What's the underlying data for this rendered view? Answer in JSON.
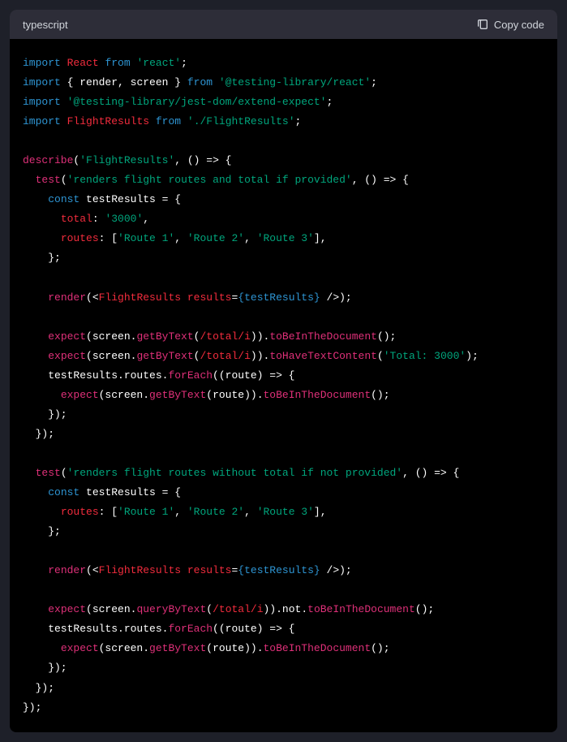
{
  "header": {
    "language": "typescript",
    "copyLabel": "Copy code"
  },
  "code": {
    "l1": {
      "import": "import",
      "react": "React",
      "from": "from",
      "reactStr": "'react'"
    },
    "l2": {
      "import": "import",
      "render": "render",
      "screen": "screen",
      "from": "from",
      "lib": "'@testing-library/react'"
    },
    "l3": {
      "import": "import",
      "jestDom": "'@testing-library/jest-dom/extend-expect'"
    },
    "l4": {
      "import": "import",
      "flightResults": "FlightResults",
      "from": "from",
      "path": "'./FlightResults'"
    },
    "l5": {
      "describe": "describe",
      "str": "'FlightResults'"
    },
    "l6": {
      "test": "test",
      "str": "'renders flight routes and total if provided'"
    },
    "l7": {
      "const": "const",
      "var": "testResults"
    },
    "l8": {
      "total": "total",
      "val": "'3000'"
    },
    "l9": {
      "routes": "routes",
      "r1": "'Route 1'",
      "r2": "'Route 2'",
      "r3": "'Route 3'"
    },
    "l10": {
      "render": "render",
      "comp": "FlightResults",
      "results": "results",
      "val": "{testResults}"
    },
    "l11": {
      "expect": "expect",
      "getByText": "getByText",
      "regex": "/total/i",
      "toBeInDoc": "toBeInTheDocument"
    },
    "l12": {
      "expect": "expect",
      "getByText": "getByText",
      "regex": "/total/i",
      "toHaveText": "toHaveTextContent",
      "str": "'Total: 3000'"
    },
    "l13": {
      "forEach": "forEach",
      "route": "route"
    },
    "l14": {
      "expect": "expect",
      "getByText": "getByText",
      "route": "route",
      "toBeInDoc": "toBeInTheDocument"
    },
    "l15": {
      "test": "test",
      "str": "'renders flight routes without total if not provided'"
    },
    "l16": {
      "const": "const",
      "var": "testResults"
    },
    "l17": {
      "routes": "routes",
      "r1": "'Route 1'",
      "r2": "'Route 2'",
      "r3": "'Route 3'"
    },
    "l18": {
      "render": "render",
      "comp": "FlightResults",
      "results": "results",
      "val": "{testResults}"
    },
    "l19": {
      "expect": "expect",
      "queryByText": "queryByText",
      "regex": "/total/i",
      "not": "not",
      "toBeInDoc": "toBeInTheDocument"
    },
    "l20": {
      "forEach": "forEach",
      "route": "route"
    },
    "l21": {
      "expect": "expect",
      "getByText": "getByText",
      "route": "route",
      "toBeInDoc": "toBeInTheDocument"
    }
  }
}
